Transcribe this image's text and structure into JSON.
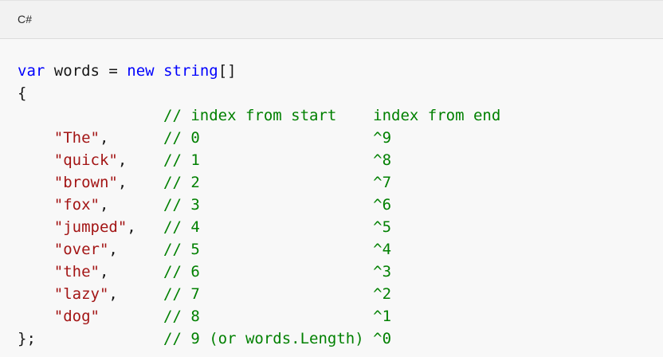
{
  "code_block": {
    "language": "C#",
    "lines": [
      [
        {
          "t": "kw",
          "v": "var"
        },
        {
          "t": "pl",
          "v": " words = "
        },
        {
          "t": "kw",
          "v": "new"
        },
        {
          "t": "pl",
          "v": " "
        },
        {
          "t": "kw",
          "v": "string"
        },
        {
          "t": "pl",
          "v": "[]"
        }
      ],
      [
        {
          "t": "pl",
          "v": "{"
        }
      ],
      [
        {
          "t": "pl",
          "v": "                "
        },
        {
          "t": "cm",
          "v": "// index from start    index from end"
        }
      ],
      [
        {
          "t": "pl",
          "v": "    "
        },
        {
          "t": "str",
          "v": "\"The\""
        },
        {
          "t": "pl",
          "v": ",      "
        },
        {
          "t": "cm",
          "v": "// 0                   ^9"
        }
      ],
      [
        {
          "t": "pl",
          "v": "    "
        },
        {
          "t": "str",
          "v": "\"quick\""
        },
        {
          "t": "pl",
          "v": ",    "
        },
        {
          "t": "cm",
          "v": "// 1                   ^8"
        }
      ],
      [
        {
          "t": "pl",
          "v": "    "
        },
        {
          "t": "str",
          "v": "\"brown\""
        },
        {
          "t": "pl",
          "v": ",    "
        },
        {
          "t": "cm",
          "v": "// 2                   ^7"
        }
      ],
      [
        {
          "t": "pl",
          "v": "    "
        },
        {
          "t": "str",
          "v": "\"fox\""
        },
        {
          "t": "pl",
          "v": ",      "
        },
        {
          "t": "cm",
          "v": "// 3                   ^6"
        }
      ],
      [
        {
          "t": "pl",
          "v": "    "
        },
        {
          "t": "str",
          "v": "\"jumped\""
        },
        {
          "t": "pl",
          "v": ",   "
        },
        {
          "t": "cm",
          "v": "// 4                   ^5"
        }
      ],
      [
        {
          "t": "pl",
          "v": "    "
        },
        {
          "t": "str",
          "v": "\"over\""
        },
        {
          "t": "pl",
          "v": ",     "
        },
        {
          "t": "cm",
          "v": "// 5                   ^4"
        }
      ],
      [
        {
          "t": "pl",
          "v": "    "
        },
        {
          "t": "str",
          "v": "\"the\""
        },
        {
          "t": "pl",
          "v": ",      "
        },
        {
          "t": "cm",
          "v": "// 6                   ^3"
        }
      ],
      [
        {
          "t": "pl",
          "v": "    "
        },
        {
          "t": "str",
          "v": "\"lazy\""
        },
        {
          "t": "pl",
          "v": ",     "
        },
        {
          "t": "cm",
          "v": "// 7                   ^2"
        }
      ],
      [
        {
          "t": "pl",
          "v": "    "
        },
        {
          "t": "str",
          "v": "\"dog\""
        },
        {
          "t": "pl",
          "v": "       "
        },
        {
          "t": "cm",
          "v": "// 8                   ^1"
        }
      ],
      [
        {
          "t": "pl",
          "v": "};              "
        },
        {
          "t": "cm",
          "v": "// 9 (or words.Length) ^0"
        }
      ]
    ]
  },
  "colors": {
    "keyword": "#0101fd",
    "string": "#a31515",
    "comment": "#008000",
    "plain": "#171717",
    "background": "#f8f8f8",
    "header_background": "#f2f2f2"
  }
}
